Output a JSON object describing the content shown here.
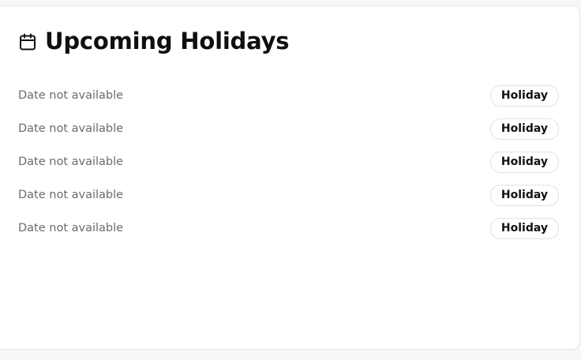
{
  "card": {
    "title": "Upcoming Holidays",
    "icon": "calendar-icon",
    "items": [
      {
        "date": "Date not available",
        "badge": "Holiday"
      },
      {
        "date": "Date not available",
        "badge": "Holiday"
      },
      {
        "date": "Date not available",
        "badge": "Holiday"
      },
      {
        "date": "Date not available",
        "badge": "Holiday"
      },
      {
        "date": "Date not available",
        "badge": "Holiday"
      }
    ]
  },
  "colors": {
    "background": "#f7f7f7",
    "card": "#ffffff",
    "title": "#0f0f0f",
    "muted_text": "#6b6b6b",
    "badge_border": "#e2e2e2"
  }
}
